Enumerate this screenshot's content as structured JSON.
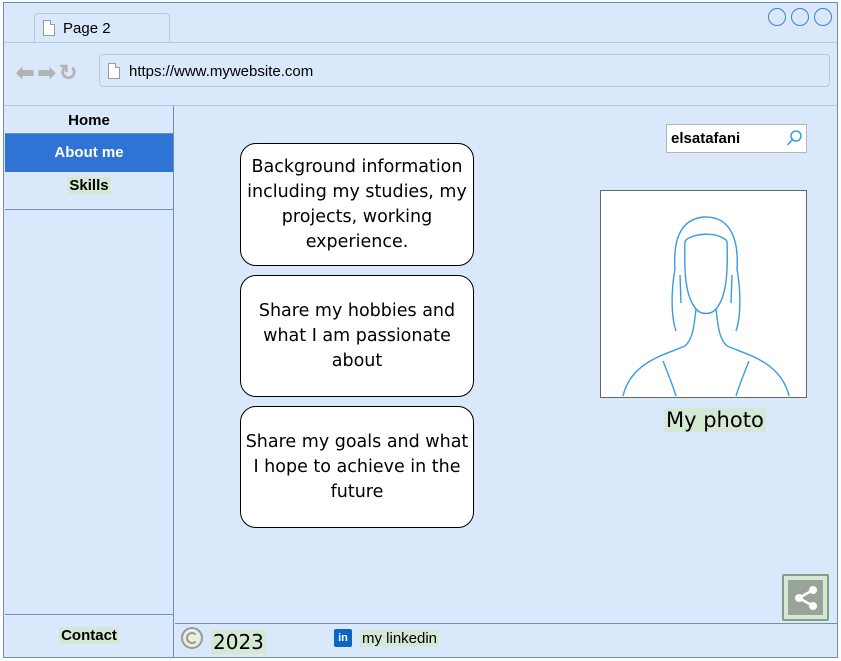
{
  "browser": {
    "tab_title": "Page 2",
    "url": "https://www.mywebsite.com"
  },
  "sidebar": {
    "items": [
      {
        "label": "Home"
      },
      {
        "label": "About me"
      },
      {
        "label": "Skills"
      }
    ],
    "footer_label": "Contact"
  },
  "content": {
    "cards": [
      {
        "text": "Background information including my studies, my projects, working experience."
      },
      {
        "text": "Share my hobbies and what I am passionate about"
      },
      {
        "text": "Share my goals and what I hope to achieve in the future"
      }
    ]
  },
  "search": {
    "value": "elsatafani"
  },
  "photo": {
    "label": "My photo"
  },
  "footer": {
    "year": "2023",
    "linkedin_icon_text": "in",
    "linkedin_label": "my linkedin"
  },
  "colors": {
    "background": "#dae8fc",
    "border": "#6c8ebf",
    "active_nav": "#2f73d4",
    "highlight": "#d5e8d4"
  }
}
